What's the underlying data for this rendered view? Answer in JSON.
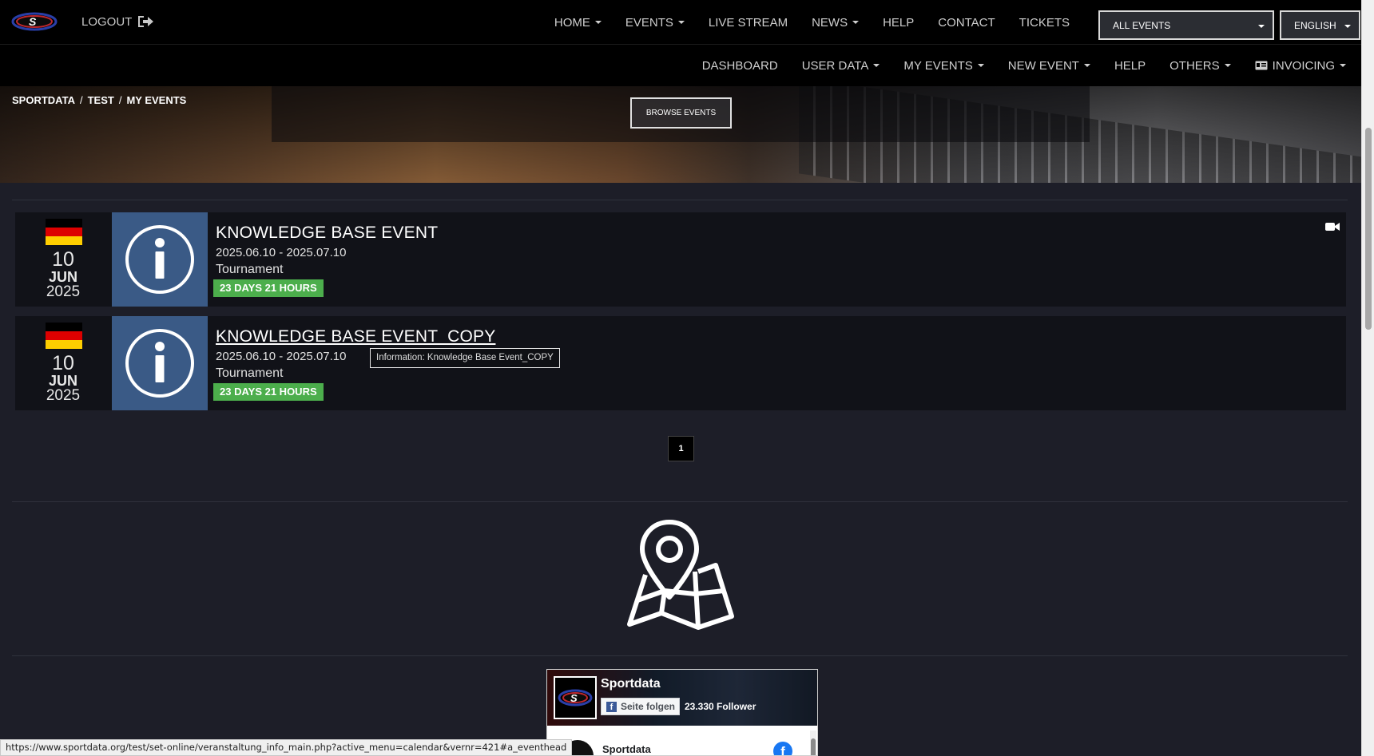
{
  "nav": {
    "logout": "LOGOUT",
    "main_menu": [
      {
        "label": "HOME",
        "dropdown": true
      },
      {
        "label": "EVENTS",
        "dropdown": true
      },
      {
        "label": "LIVE STREAM",
        "dropdown": false
      },
      {
        "label": "NEWS",
        "dropdown": true
      },
      {
        "label": "HELP",
        "dropdown": false
      },
      {
        "label": "CONTACT",
        "dropdown": false
      },
      {
        "label": "TICKETS",
        "dropdown": false
      }
    ],
    "events_select": "ALL EVENTS",
    "language_select": "ENGLISH",
    "sub_menu": [
      {
        "label": "DASHBOARD",
        "dropdown": false
      },
      {
        "label": "USER DATA",
        "dropdown": true
      },
      {
        "label": "MY EVENTS",
        "dropdown": true
      },
      {
        "label": "NEW EVENT",
        "dropdown": true
      },
      {
        "label": "HELP",
        "dropdown": false
      },
      {
        "label": "OTHERS",
        "dropdown": true
      },
      {
        "label": "INVOICING",
        "dropdown": true
      }
    ]
  },
  "breadcrumb": [
    "SPORTDATA",
    "TEST",
    "MY EVENTS"
  ],
  "hero": {
    "browse_button": "BROWSE EVENTS"
  },
  "events": [
    {
      "day": "10",
      "month": "JUN",
      "year": "2025",
      "flag": "germany-flag",
      "title": "KNOWLEDGE BASE EVENT",
      "dates": "2025.06.10 - 2025.07.10",
      "type": "Tournament",
      "countdown": "23 DAYS 21 HOURS",
      "has_stream": true
    },
    {
      "day": "10",
      "month": "JUN",
      "year": "2025",
      "flag": "germany-flag",
      "title": "KNOWLEDGE BASE EVENT_COPY",
      "dates": "2025.06.10 - 2025.07.10",
      "type": "Tournament",
      "countdown": "23 DAYS 21 HOURS",
      "has_stream": false
    }
  ],
  "tooltip": "Information: Knowledge Base Event_COPY",
  "pagination": {
    "current": "1"
  },
  "facebook": {
    "page_name": "Sportdata",
    "follow_label": "Seite folgen",
    "followers": "23.330 Follower",
    "post_author": "Sportdata"
  },
  "status_url": "https://www.sportdata.org/test/set-online/veranstaltung_info_main.php?active_menu=calendar&vernr=421#a_eventhead",
  "colors": {
    "background": "#1d1e28",
    "info_tile": "#3a5a86",
    "countdown_badge": "#4cae4c",
    "navbar": "#000000"
  }
}
